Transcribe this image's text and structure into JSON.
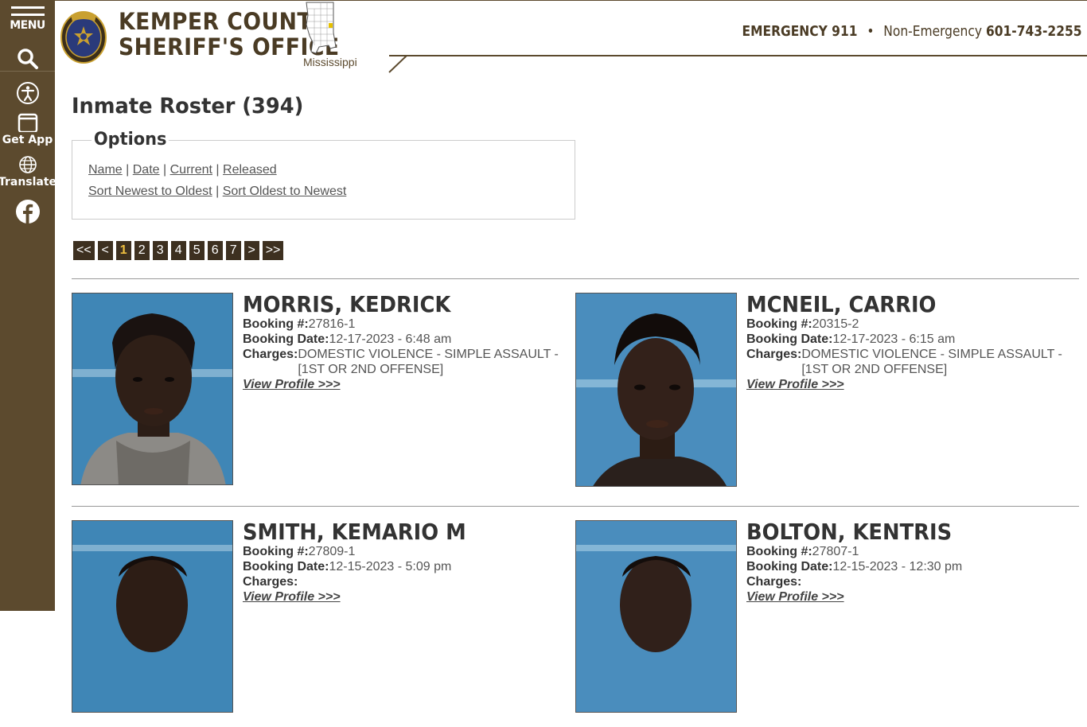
{
  "sidebar": {
    "menu_label": "MENU",
    "app_label": "Get App",
    "translate_label": "Translate"
  },
  "header": {
    "title_line1": "KEMPER COUNTY",
    "title_line2": "SHERIFF'S OFFICE",
    "state": "Mississippi",
    "emergency_label": "EMERGENCY 911",
    "separator": "•",
    "nonemergency_label": "Non-Emergency",
    "nonemergency_phone": "601-743-2255"
  },
  "page": {
    "title": "Inmate Roster (394)"
  },
  "options": {
    "legend": "Options",
    "sort_links": [
      "Name",
      "Date",
      "Current",
      "Released"
    ],
    "order_links": [
      "Sort Newest to Oldest",
      "Sort Oldest to Newest"
    ],
    "divider": "|"
  },
  "pagination": [
    "<<",
    "<",
    "1",
    "2",
    "3",
    "4",
    "5",
    "6",
    "7",
    ">",
    ">>"
  ],
  "pagination_active": "1",
  "inmates": [
    {
      "name": "MORRIS, KEDRICK",
      "booking_label": "Booking #:",
      "booking": "27816-1",
      "date_label": "Booking Date:",
      "date": "12-17-2023 - 6:48 am",
      "charges_label": "Charges:",
      "charges": "DOMESTIC VIOLENCE - SIMPLE ASSAULT - [1ST OR 2ND OFFENSE]",
      "link": "View Profile >>>"
    },
    {
      "name": "MCNEIL, CARRIO",
      "booking_label": "Booking #:",
      "booking": "20315-2",
      "date_label": "Booking Date:",
      "date": "12-17-2023 - 6:15 am",
      "charges_label": "Charges:",
      "charges": "DOMESTIC VIOLENCE - SIMPLE ASSAULT - [1ST OR 2ND OFFENSE]",
      "link": "View Profile >>>"
    },
    {
      "name": "SMITH, KEMARIO M",
      "booking_label": "Booking #:",
      "booking": "27809-1",
      "date_label": "Booking Date:",
      "date": "12-15-2023 - 5:09 pm",
      "charges_label": "Charges:",
      "charges": "",
      "link": "View Profile >>>"
    },
    {
      "name": "BOLTON, KENTRIS",
      "booking_label": "Booking #:",
      "booking": "27807-1",
      "date_label": "Booking Date:",
      "date": "12-15-2023 - 12:30 pm",
      "charges_label": "Charges:",
      "charges": "",
      "link": "View Profile >>>"
    }
  ],
  "colors": {
    "brand_brown": "#5c4a2e",
    "pager_bg": "#3d3020",
    "pager_active": "#f0c040",
    "photo_bg": "#3f86b6"
  }
}
